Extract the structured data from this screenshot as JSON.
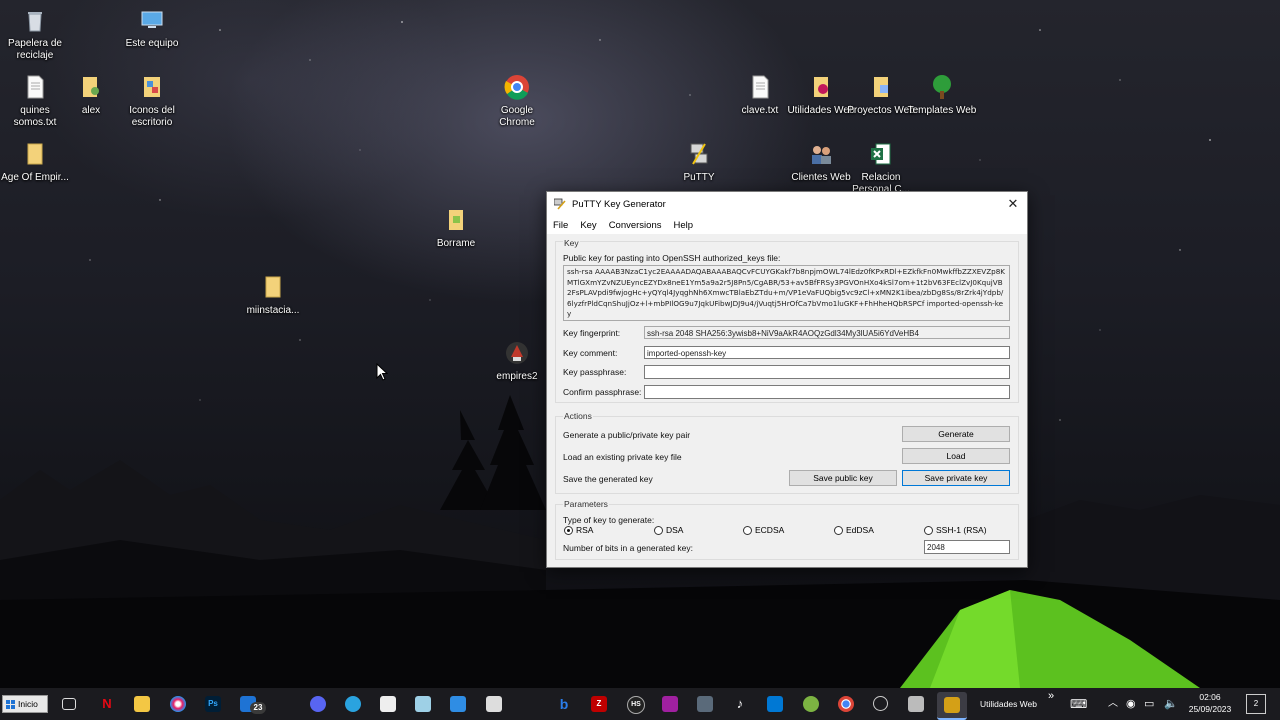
{
  "desktop": {
    "icons": [
      {
        "label": "Papelera de reciclaje",
        "icon": "recycle-bin-icon"
      },
      {
        "label": "Este equipo",
        "icon": "computer-icon"
      },
      {
        "label": "quines somos.txt",
        "icon": "text-file-icon"
      },
      {
        "label": "alex",
        "icon": "user-folder-icon"
      },
      {
        "label": "Iconos del escritorio",
        "icon": "shortcut-icon"
      },
      {
        "label": "Age Of Empir...",
        "icon": "folder-icon"
      },
      {
        "label": "Google Chrome",
        "icon": "chrome-icon"
      },
      {
        "label": "clave.txt",
        "icon": "text-file-icon"
      },
      {
        "label": "Utilidades Web",
        "icon": "folder-icon"
      },
      {
        "label": "Proyectos Web",
        "icon": "folder-icon"
      },
      {
        "label": "Templates Web",
        "icon": "tree-icon"
      },
      {
        "label": "PuTTY",
        "icon": "putty-icon"
      },
      {
        "label": "Clientes Web",
        "icon": "people-icon"
      },
      {
        "label": "Relacion Personal C...",
        "icon": "excel-icon"
      },
      {
        "label": "Borrame",
        "icon": "folder-icon"
      },
      {
        "label": "miinstacia...",
        "icon": "folder-icon"
      },
      {
        "label": "empires2",
        "icon": "game-icon"
      }
    ]
  },
  "window": {
    "title": "PuTTY Key Generator",
    "menu": [
      "File",
      "Key",
      "Conversions",
      "Help"
    ],
    "key_group": "Key",
    "public_key_label": "Public key for pasting into OpenSSH authorized_keys file:",
    "public_key_text": "ssh-rsa AAAAB3NzaC1yc2EAAAADAQABAAABAQCvFCUYGKakf7b8npjmOWL74lEdz0fKPxRDl+EZkfkFn0MwkffbZZXEVZp8KMTlGXmYZvNZUEyncEZYDx8neE1Ym5a9a2r5J8Pn5/CgABR/53+av5BfFRSy3PGVOnHXo4kSl7om+1t2bV63FEclZvJ0KqujVB2FsPLAVpdi9fwjogHc+yQYql4JyqghNh6XmwcTBlaEbZTdu+m/VP1eVaFUQbig5vc9zCl+xMN2K1ibea/zbDg8Ss/8rZrk4jYdpb/6lyzfrPldCqnShuJjOz+l+mbPIlOG9u7JqkUFibwJDJ9u4/jVuqtj5HrOfCa7bVmo1luGKF+FhHheHQbRSPCf imported-openssh-key",
    "fingerprint_label": "Key fingerprint:",
    "fingerprint_value": "ssh-rsa 2048 SHA256:3ywisb8+NiV9aAkR4AOQzGdl34My3lUA5i6YdVeHB4",
    "comment_label": "Key comment:",
    "comment_value": "imported-openssh-key",
    "passphrase_label": "Key passphrase:",
    "passphrase_value": "",
    "confirm_label": "Confirm passphrase:",
    "confirm_value": "",
    "actions_group": "Actions",
    "generate_text": "Generate a public/private key pair",
    "generate_button": "Generate",
    "load_text": "Load an existing private key file",
    "load_button": "Load",
    "save_text": "Save the generated key",
    "save_public_button": "Save public key",
    "save_private_button": "Save private key",
    "params_group": "Parameters",
    "type_label": "Type of key to generate:",
    "key_types": [
      "RSA",
      "DSA",
      "ECDSA",
      "EdDSA",
      "SSH-1 (RSA)"
    ],
    "selected_key_type": "RSA",
    "bits_label": "Number of bits in a generated key:",
    "bits_value": "2048"
  },
  "taskbar": {
    "start_label": "Inicio",
    "mail_badge": "23",
    "active_window_label": "Utilidades Web",
    "overflow": "»",
    "time": "02:06",
    "date": "25/09/2023",
    "notification_count": "2"
  }
}
